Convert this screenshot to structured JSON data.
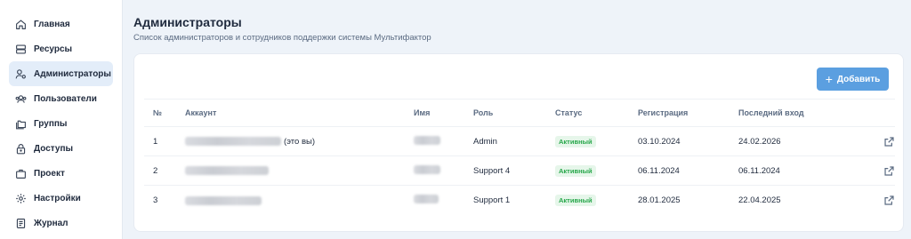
{
  "sidebar": {
    "items": [
      {
        "label": "Главная",
        "icon": "home-icon",
        "active": false
      },
      {
        "label": "Ресурсы",
        "icon": "server-icon",
        "active": false
      },
      {
        "label": "Администраторы",
        "icon": "user-gear-icon",
        "active": true
      },
      {
        "label": "Пользователи",
        "icon": "users-icon",
        "active": false
      },
      {
        "label": "Группы",
        "icon": "folders-icon",
        "active": false
      },
      {
        "label": "Доступы",
        "icon": "lock-icon",
        "active": false
      },
      {
        "label": "Проект",
        "icon": "briefcase-icon",
        "active": false
      },
      {
        "label": "Настройки",
        "icon": "gear-icon",
        "active": false
      },
      {
        "label": "Журнал",
        "icon": "journal-icon",
        "active": false
      }
    ]
  },
  "header": {
    "title": "Администраторы",
    "subtitle": "Список администраторов и сотрудников поддержки системы Мультифактор"
  },
  "toolbar": {
    "add_label": "Добавить"
  },
  "table": {
    "columns": [
      "№",
      "Аккаунт",
      "Имя",
      "Роль",
      "Статус",
      "Регистрация",
      "Последний вход"
    ],
    "rows": [
      {
        "num": "1",
        "account_suffix": "(это вы)",
        "role": "Admin",
        "status": "Активный",
        "registered": "03.10.2024",
        "last_login": "24.02.2026"
      },
      {
        "num": "2",
        "account_suffix": "",
        "role": "Support 4",
        "status": "Активный",
        "registered": "06.11.2024",
        "last_login": "06.11.2024"
      },
      {
        "num": "3",
        "account_suffix": "",
        "role": "Support 1",
        "status": "Активный",
        "registered": "28.01.2025",
        "last_login": "22.04.2025"
      }
    ]
  },
  "colors": {
    "accent": "#5b9fe0",
    "active_nav": "#e3edf9",
    "status_green": "#27a74a"
  }
}
